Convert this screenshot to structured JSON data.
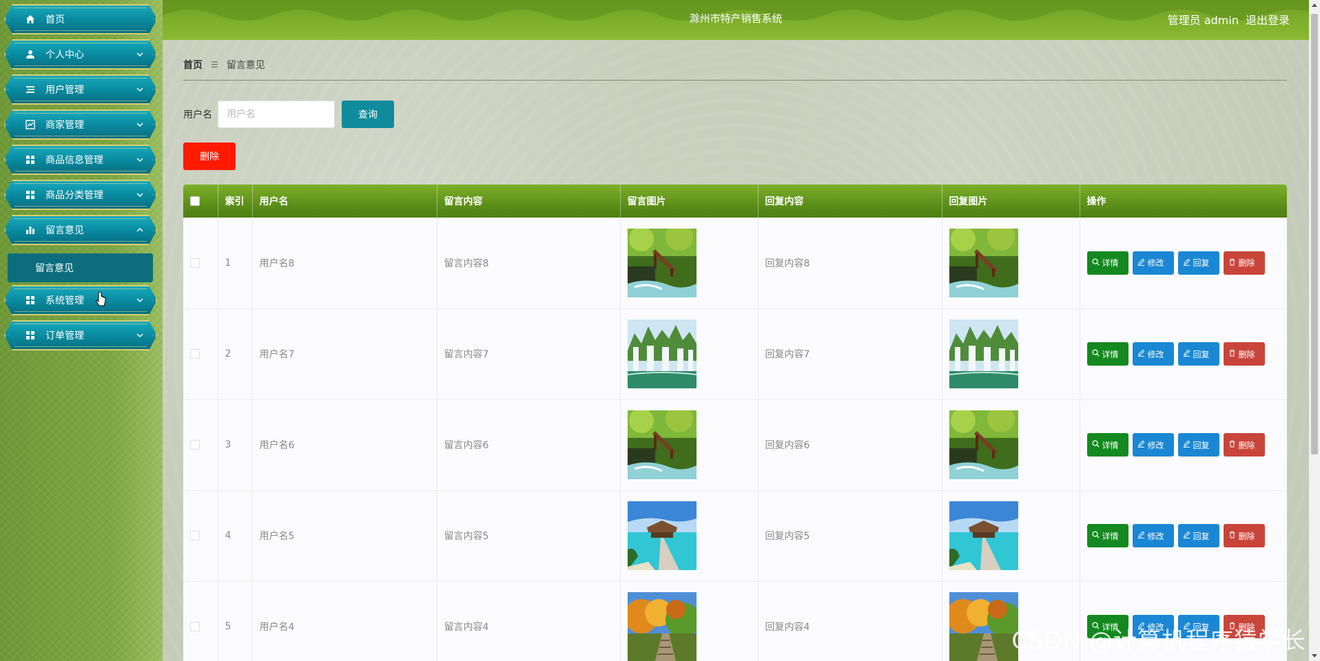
{
  "header": {
    "title": "滁州市特产销售系统",
    "user_label": "管理员 admin",
    "logout": "退出登录"
  },
  "sidebar": {
    "items": [
      {
        "label": "首页",
        "icon": "home-icon",
        "expandable": false
      },
      {
        "label": "个人中心",
        "icon": "user-icon",
        "expandable": true
      },
      {
        "label": "用户管理",
        "icon": "list-icon",
        "expandable": true
      },
      {
        "label": "商家管理",
        "icon": "chart-icon",
        "expandable": true
      },
      {
        "label": "商品信息管理",
        "icon": "grid-icon",
        "expandable": true
      },
      {
        "label": "商品分类管理",
        "icon": "grid-icon",
        "expandable": true
      },
      {
        "label": "留言意见",
        "icon": "bar-chart-icon",
        "expandable": true,
        "expanded": true
      },
      {
        "label": "系统管理",
        "icon": "grid-icon",
        "expandable": true
      },
      {
        "label": "订单管理",
        "icon": "grid-icon",
        "expandable": true
      }
    ],
    "submenu": {
      "label": "留言意见"
    }
  },
  "breadcrumb": {
    "home": "首页",
    "current": "留言意见"
  },
  "search": {
    "label": "用户名",
    "placeholder": "用户名",
    "button": "查询"
  },
  "bulk_delete": "删除",
  "table": {
    "columns": [
      "索引",
      "用户名",
      "留言内容",
      "留言图片",
      "回复内容",
      "回复图片",
      "操作"
    ],
    "actions": {
      "detail": "详情",
      "edit": "修改",
      "reply": "回复",
      "delete": "删除"
    },
    "rows": [
      {
        "index": "1",
        "username": "用户名8",
        "content": "留言内容8",
        "reply": "回复内容8",
        "image": "waterfall-bridge"
      },
      {
        "index": "2",
        "username": "用户名7",
        "content": "留言内容7",
        "reply": "回复内容7",
        "image": "waterfall-cliffs"
      },
      {
        "index": "3",
        "username": "用户名6",
        "content": "留言内容6",
        "reply": "回复内容6",
        "image": "waterfall-bridge"
      },
      {
        "index": "4",
        "username": "用户名5",
        "content": "留言内容5",
        "reply": "回复内容5",
        "image": "ocean-pier"
      },
      {
        "index": "5",
        "username": "用户名4",
        "content": "留言内容4",
        "reply": "回复内容4",
        "image": "autumn-stairs"
      }
    ]
  },
  "watermark": "CSDN @计算机程序猿学长",
  "colors": {
    "header": "#7fb12c",
    "sidebar_item": "#0a8ea3",
    "table_header": "#5d8f1a",
    "query_button": "#108b9e",
    "bulk_delete": "#ff1a00",
    "detail_button": "#14891f",
    "edit_button": "#1a87d4",
    "delete_button": "#c9453a"
  }
}
